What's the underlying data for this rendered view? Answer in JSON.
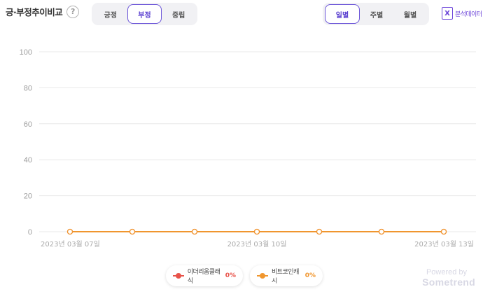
{
  "header": {
    "title": "긍·부정추이비교",
    "help_icon": "?",
    "sentiment_tabs": [
      {
        "label": "긍정",
        "active": false
      },
      {
        "label": "부정",
        "active": true
      },
      {
        "label": "중립",
        "active": false
      }
    ],
    "period_tabs": [
      {
        "label": "일별",
        "active": true
      },
      {
        "label": "주별",
        "active": false
      },
      {
        "label": "월별",
        "active": false
      }
    ],
    "export": {
      "icon": "excel-icon",
      "icon_glyph": "X",
      "label": "분석데이터"
    }
  },
  "chart_data": {
    "type": "line",
    "x": [
      "2023-03-07",
      "2023-03-08",
      "2023-03-09",
      "2023-03-10",
      "2023-03-11",
      "2023-03-12",
      "2023-03-13"
    ],
    "x_tick_labels": [
      "2023년 03월 07일",
      "2023년 03월 10일",
      "2023년 03월 13일"
    ],
    "y_ticks": [
      0,
      20,
      40,
      60,
      80,
      100
    ],
    "ylim": [
      0,
      100
    ],
    "grid": true,
    "series": [
      {
        "name": "이더리움클래식",
        "values": [
          0,
          0,
          0,
          0,
          0,
          0,
          0
        ],
        "color": "#e8534a"
      },
      {
        "name": "비트코인캐시",
        "values": [
          0,
          0,
          0,
          0,
          0,
          0,
          0
        ],
        "color": "#f0962e"
      }
    ]
  },
  "legend": [
    {
      "name": "이더리움클래식",
      "value": "0%",
      "color": "#e8534a"
    },
    {
      "name": "비트코인캐시",
      "value": "0%",
      "color": "#f0962e"
    }
  ],
  "branding": {
    "powered": "Powered by",
    "name": "Sometrend"
  },
  "colors": {
    "accent": "#6b55d8",
    "grid": "#e8e8e8"
  }
}
